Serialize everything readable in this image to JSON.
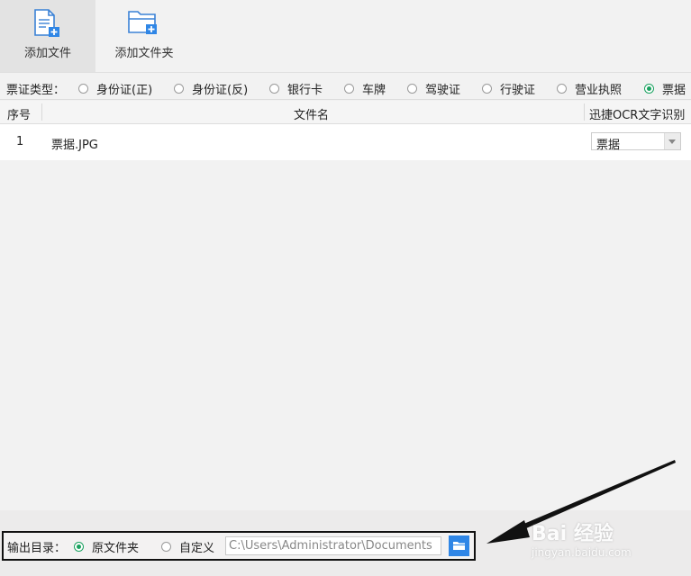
{
  "toolbar": {
    "add_file": "添加文件",
    "add_folder": "添加文件夹"
  },
  "ticket_type": {
    "label": "票证类型：",
    "options": [
      {
        "label": "身份证(正)",
        "selected": false
      },
      {
        "label": "身份证(反)",
        "selected": false
      },
      {
        "label": "银行卡",
        "selected": false
      },
      {
        "label": "车牌",
        "selected": false
      },
      {
        "label": "驾驶证",
        "selected": false
      },
      {
        "label": "行驶证",
        "selected": false
      },
      {
        "label": "营业执照",
        "selected": false
      },
      {
        "label": "票据",
        "selected": true
      }
    ]
  },
  "table": {
    "columns": [
      "序号",
      "文件名",
      "迅捷OCR文字识别"
    ],
    "rows": [
      {
        "index": "1",
        "filename": "票据.JPG",
        "ocr_type": "票据"
      }
    ]
  },
  "output": {
    "label": "输出目录：",
    "options": [
      {
        "label": "原文件夹",
        "selected": true
      },
      {
        "label": "自定义",
        "selected": false
      }
    ],
    "path": "C:\\Users\\Administrator\\Documents"
  },
  "watermark": {
    "brand": "Bai 经验",
    "url": "jingyan.baidu.com"
  },
  "colors": {
    "accent_blue": "#2f86e6",
    "radio_green": "#1aa260",
    "highlight_box": "#111111"
  }
}
